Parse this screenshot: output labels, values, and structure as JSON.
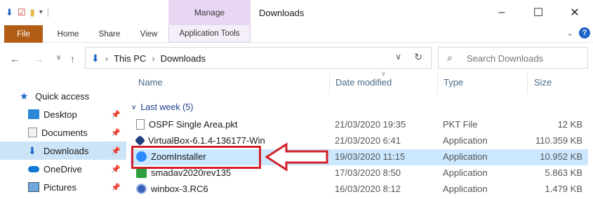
{
  "window": {
    "title": "Downloads",
    "context_tab": "Manage",
    "controls": [
      "–",
      "☐",
      "✕"
    ]
  },
  "ribbon": {
    "tabs": [
      "File",
      "Home",
      "Share",
      "View",
      "Application Tools"
    ]
  },
  "address": {
    "crumbs": [
      "This PC",
      "Downloads"
    ],
    "search_placeholder": "Search Downloads"
  },
  "sidebar": {
    "items": [
      {
        "label": "Quick access",
        "icon": "star-icon"
      },
      {
        "label": "Desktop",
        "icon": "desktop-icon"
      },
      {
        "label": "Documents",
        "icon": "documents-icon"
      },
      {
        "label": "Downloads",
        "icon": "downloads-icon"
      },
      {
        "label": "OneDrive",
        "icon": "onedrive-icon"
      },
      {
        "label": "Pictures",
        "icon": "pictures-icon"
      }
    ]
  },
  "columns": {
    "name": "Name",
    "date": "Date modified",
    "type": "Type",
    "size": "Size"
  },
  "group_label": "Last week (5)",
  "files": [
    {
      "name": "OSPF Single Area.pkt",
      "date": "21/03/2020 19:35",
      "type": "PKT File",
      "size": "12 KB",
      "icon": "file-icon"
    },
    {
      "name": "VirtualBox-6.1.4-136177-Win",
      "date": "21/03/2020 6:41",
      "type": "Application",
      "size": "110.359 KB",
      "icon": "virtualbox-icon"
    },
    {
      "name": "ZoomInstaller",
      "date": "19/03/2020 11:15",
      "type": "Application",
      "size": "10.952 KB",
      "icon": "zoom-icon"
    },
    {
      "name": "smadav2020rev135",
      "date": "17/03/2020 8:50",
      "type": "Application",
      "size": "5.863 KB",
      "icon": "smadav-icon"
    },
    {
      "name": "winbox-3.RC6",
      "date": "16/03/2020 8:12",
      "type": "Application",
      "size": "1.479 KB",
      "icon": "winbox-icon"
    }
  ],
  "colors": {
    "file_tab": "#b25d16",
    "manage_tab": "#e8d6f2",
    "selection": "#cce8ff",
    "highlight": "#d4202a"
  }
}
